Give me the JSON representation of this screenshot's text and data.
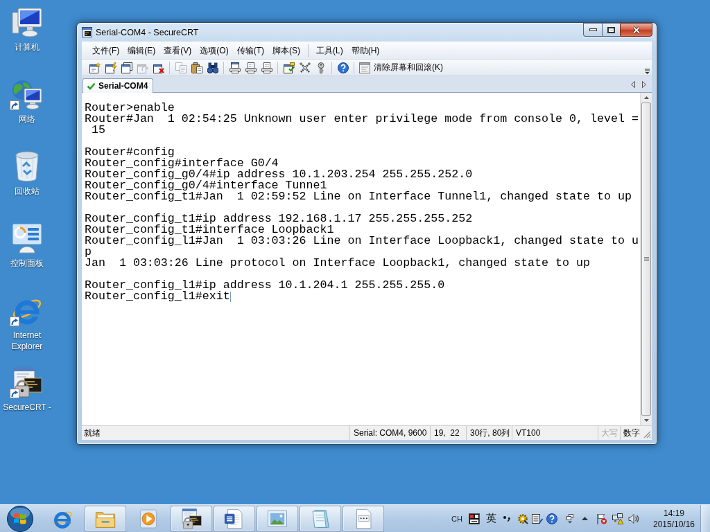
{
  "desktop": {
    "icons": [
      {
        "kind": "computer",
        "label": "计算机",
        "shortcut": false
      },
      {
        "kind": "network",
        "label": "网络",
        "shortcut": true
      },
      {
        "kind": "recyclebin",
        "label": "回收站",
        "shortcut": false
      },
      {
        "kind": "controlpanel",
        "label": "控制面板",
        "shortcut": false
      },
      {
        "kind": "browser",
        "label": "Internet Explorer",
        "shortcut": true
      },
      {
        "kind": "terminal",
        "label": "SecureCRT -",
        "shortcut": true
      }
    ]
  },
  "window": {
    "title": "Serial-COM4 - SecureCRT",
    "menu": [
      [
        "文件(F)",
        "编辑(E)",
        "查看(V)",
        "选项(O)",
        "传输(T)",
        "脚本(S)"
      ],
      [
        "工具(L)",
        "帮助(H)"
      ]
    ],
    "toolbar": [
      [
        {
          "kind": "connect",
          "disabled": false
        },
        {
          "kind": "quickconnect",
          "disabled": false
        },
        {
          "kind": "tab",
          "disabled": false
        },
        {
          "kind": "reconnect",
          "disabled": true
        },
        {
          "kind": "disconnect",
          "disabled": false
        }
      ],
      [
        {
          "kind": "copy",
          "disabled": true
        },
        {
          "kind": "paste",
          "disabled": false
        },
        {
          "kind": "find",
          "disabled": false
        }
      ],
      [
        {
          "kind": "printscreen",
          "disabled": false
        },
        {
          "kind": "printselection",
          "disabled": false
        },
        {
          "kind": "print",
          "disabled": false
        }
      ],
      [
        {
          "kind": "sessionoptions",
          "disabled": false
        },
        {
          "kind": "globaloptions",
          "disabled": false
        },
        {
          "kind": "keymap",
          "disabled": false
        }
      ],
      [
        {
          "kind": "help",
          "disabled": false
        }
      ],
      [
        {
          "kind": "clear",
          "label": "清除屏幕和回滚(K)",
          "disabled": false
        }
      ]
    ],
    "tabs": [
      {
        "label": "Serial-COM4",
        "selected": true,
        "connected": true
      }
    ],
    "terminal": {
      "blocks": [
        [
          "Router>enable",
          "Router#Jan  1 02:54:25 Unknown user enter privilege mode from console 0, level =",
          " 15"
        ],
        [
          "Router#config",
          "Router_config#interface G0/4",
          "Router_config_g0/4#ip address 10.1.203.254 255.255.252.0",
          "Router_config_g0/4#interface Tunne1",
          "Router_config_t1#Jan  1 02:59:52 Line on Interface Tunnel1, changed state to up"
        ],
        [
          "Router_config_t1#ip address 192.168.1.17 255.255.255.252",
          "Router_config_t1#interface Loopback1",
          "Router_config_l1#Jan  1 03:03:26 Line on Interface Loopback1, changed state to u",
          "p",
          "Jan  1 03:03:26 Line protocol on Interface Loopback1, changed state to up"
        ],
        [
          "Router_config_l1#ip address 10.1.204.1 255.255.255.0",
          "Router_config_l1#exit"
        ]
      ],
      "cursor": true
    },
    "status_bar": {
      "text": "就绪",
      "connection": "Serial: COM4, 9600",
      "cursor_position": "19,  22",
      "size": "30行, 80列",
      "emulation": "VT100",
      "caps_lock": {
        "label": "大写",
        "on": false
      },
      "num_lock": {
        "label": "数字",
        "on": true
      }
    }
  },
  "taskbar": {
    "apps": [
      {
        "kind": "browser",
        "running": false
      },
      {
        "kind": "folder",
        "running": true
      },
      {
        "kind": "media",
        "running": false
      },
      {
        "kind": "terminal",
        "running": true
      },
      {
        "kind": "document",
        "running": true
      },
      {
        "kind": "picture",
        "running": true
      },
      {
        "kind": "notepad",
        "running": true
      },
      {
        "kind": "window",
        "running": true
      }
    ],
    "tray": {
      "language": "CH",
      "input_mode": "英",
      "time": "14:19",
      "date": "2015/10/16"
    }
  }
}
